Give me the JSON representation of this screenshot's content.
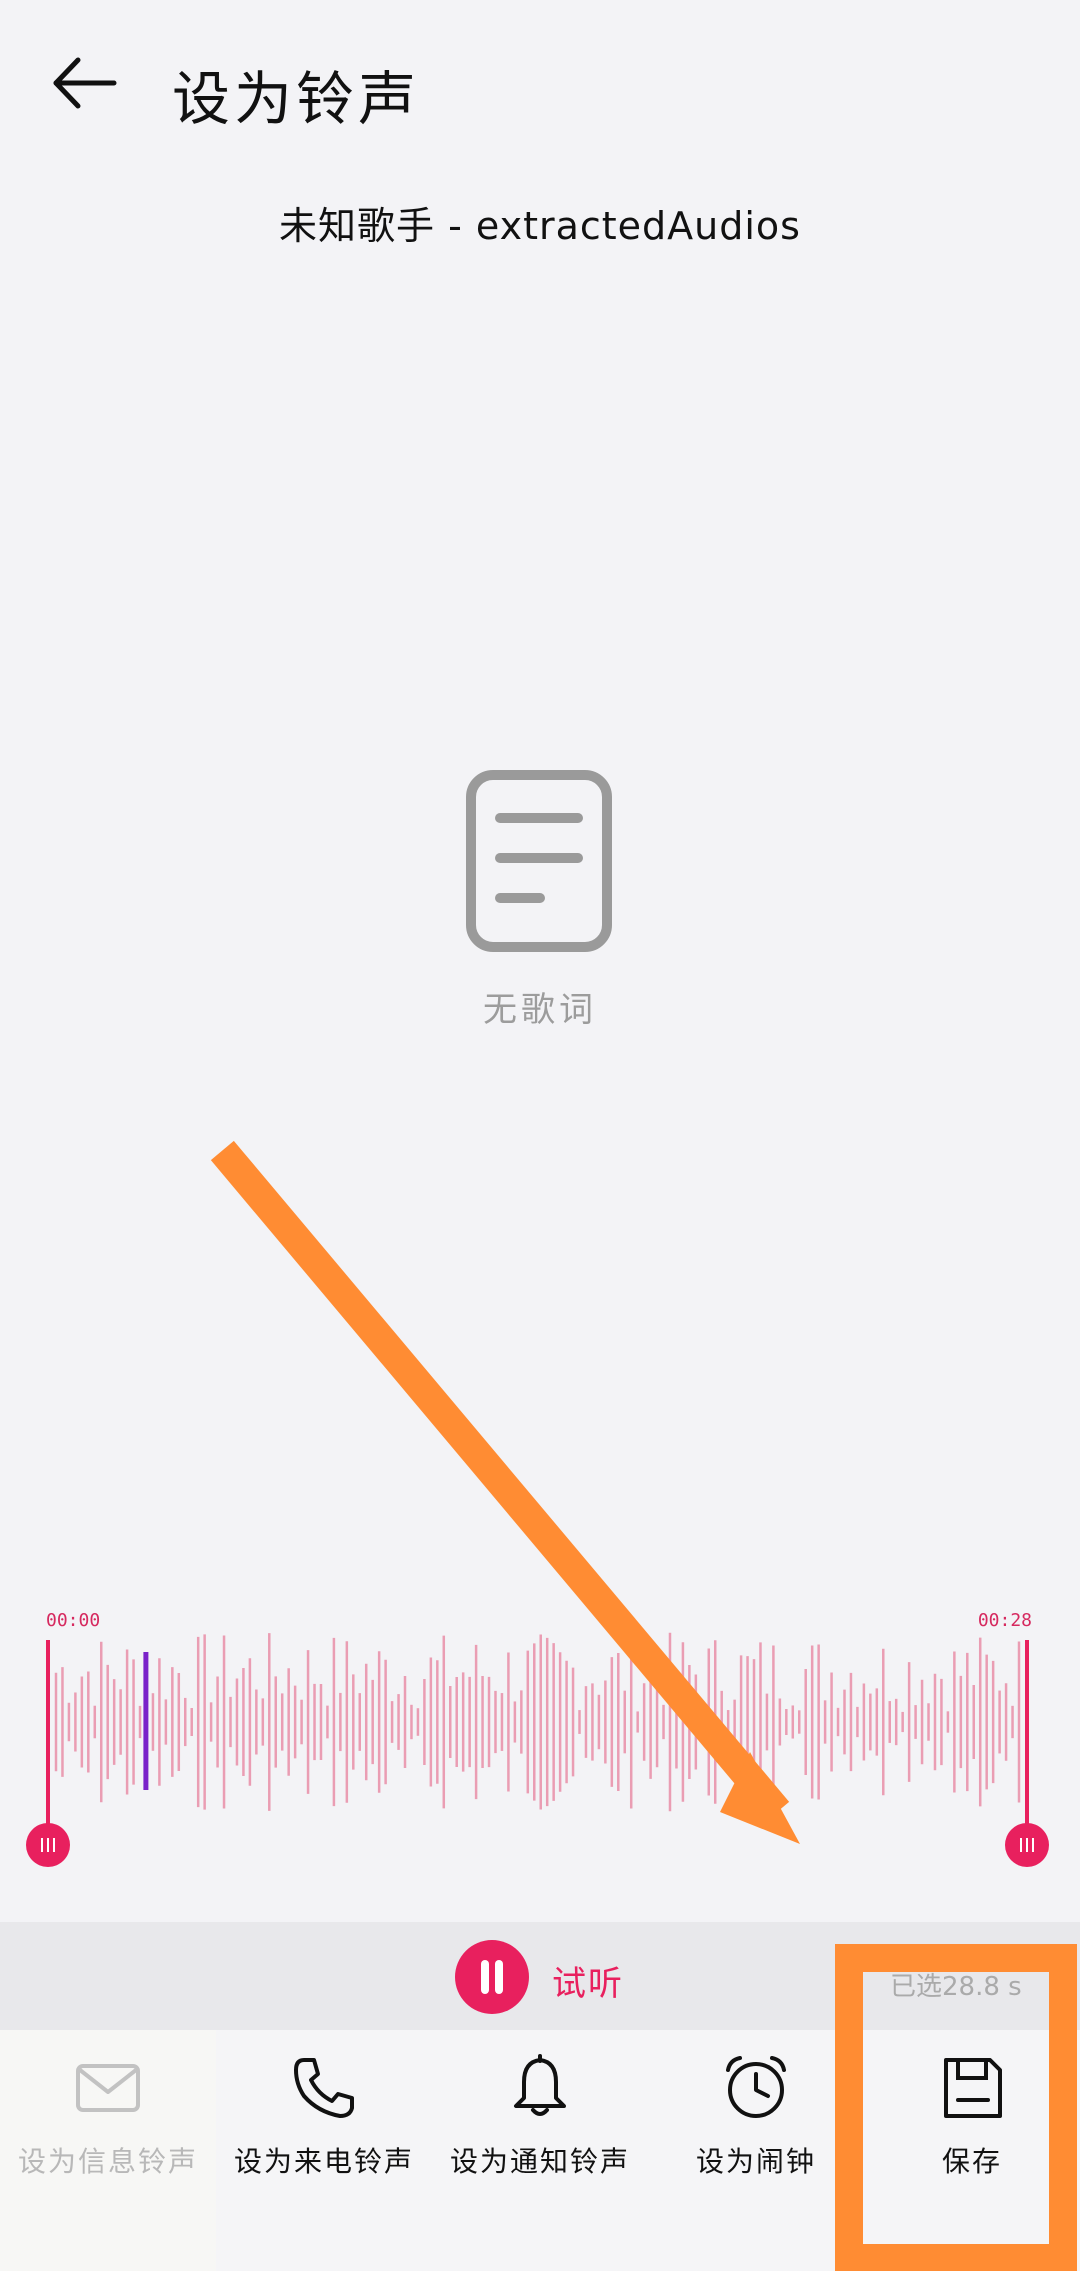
{
  "header": {
    "title": "设为铃声",
    "back_icon": "arrow-left-icon"
  },
  "song": {
    "title": "未知歌手 - extractedAudios"
  },
  "lyrics": {
    "empty_text": "无歌词",
    "icon": "document-lines-icon"
  },
  "trim": {
    "start_time": "00:00",
    "end_time": "00:28",
    "playhead_fraction": 0.1
  },
  "preview": {
    "label": "试听",
    "selected_text": "已选28.8 s",
    "state_icon": "pause-icon"
  },
  "actions": [
    {
      "label": "设为信息铃声",
      "icon": "envelope-icon",
      "enabled": false
    },
    {
      "label": "设为来电铃声",
      "icon": "phone-icon",
      "enabled": true
    },
    {
      "label": "设为通知铃声",
      "icon": "bell-icon",
      "enabled": true
    },
    {
      "label": "设为闹钟",
      "icon": "alarm-clock-icon",
      "enabled": true
    },
    {
      "label": "保存",
      "icon": "save-icon",
      "enabled": true
    }
  ],
  "colors": {
    "accent": "#e8205e",
    "waveform": "#ea9db3",
    "playhead": "#7a22c9",
    "annotation": "#ff8c33"
  }
}
